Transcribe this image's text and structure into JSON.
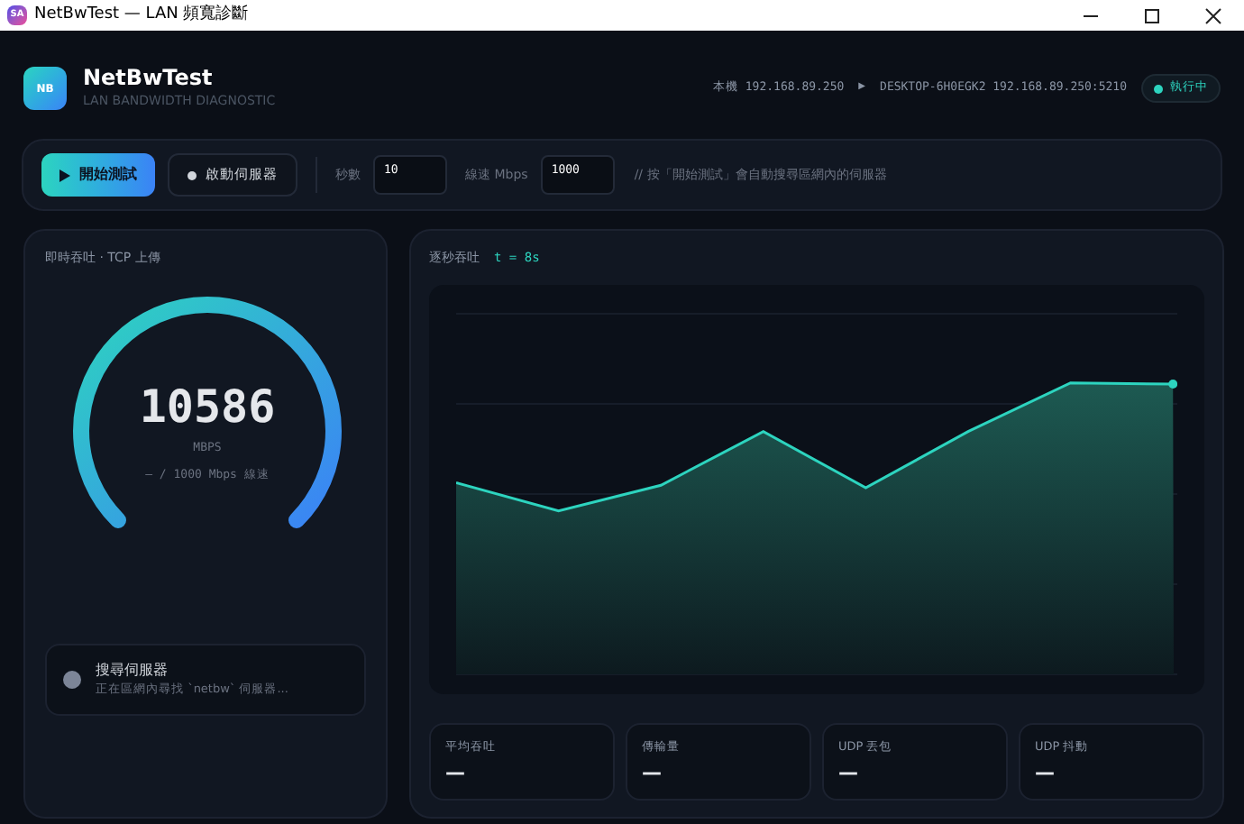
{
  "window": {
    "title": "NetBwTest — LAN 頻寬診斷",
    "icon": "SA"
  },
  "header": {
    "logo": "NB",
    "title": "NetBwTest",
    "subtitle": "LAN BANDWIDTH DIAGNOSTIC",
    "local": "本機 192.168.89.250",
    "arrow": "▶",
    "remote": "DESKTOP-6H0EGK2 192.168.89.250:5210",
    "status": "執行中"
  },
  "toolbar": {
    "start_button": "開始測試",
    "server_button": "啟動伺服器",
    "seconds_label": "秒數",
    "seconds_value": "10",
    "link_label": "線速 Mbps",
    "link_value": "1000",
    "hint": "// 按「開始測試」會自動搜尋區網內的伺服器"
  },
  "gauge": {
    "title": "即時吞吐 · TCP 上傳",
    "value": "10586",
    "unit": "MBPS",
    "sub": "— / 1000 Mbps 線速"
  },
  "server_status": {
    "title": "搜尋伺服器",
    "detail": "正在區網內尋找 `netbw` 伺服器..."
  },
  "chart": {
    "title": "逐秒吞吐",
    "time": "t = 8s"
  },
  "stats": [
    {
      "label": "平均吞吐",
      "value": "—"
    },
    {
      "label": "傳輸量",
      "value": "—"
    },
    {
      "label": "UDP 丟包",
      "value": "—"
    },
    {
      "label": "UDP 抖動",
      "value": "—"
    }
  ]
}
